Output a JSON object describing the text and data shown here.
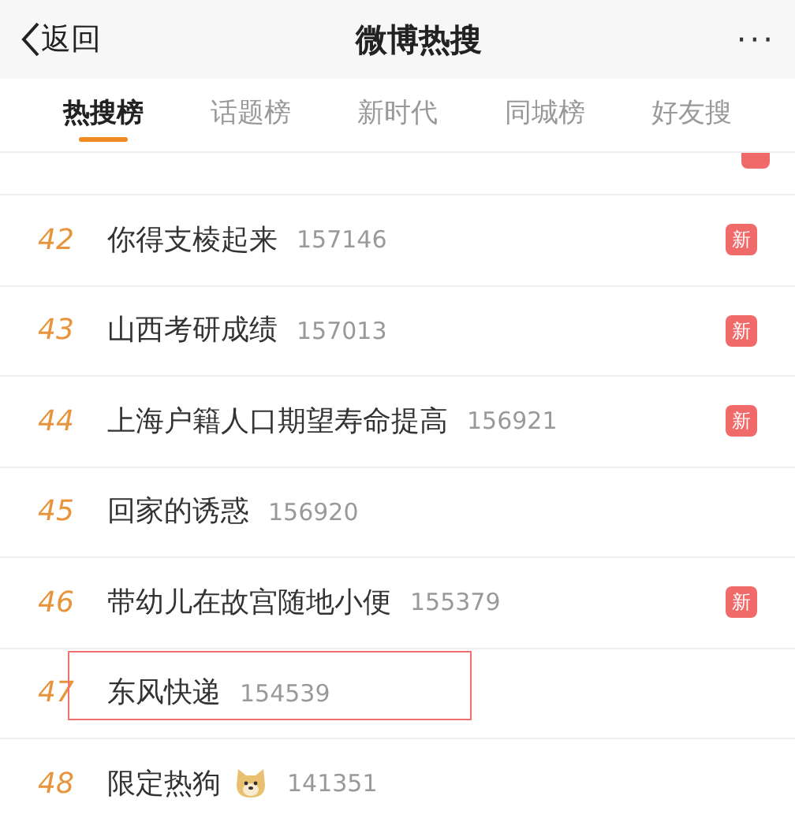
{
  "header": {
    "back": "返回",
    "title": "微博热搜",
    "more": "···"
  },
  "tabs": [
    {
      "label": "热搜榜",
      "selected": true
    },
    {
      "label": "话题榜",
      "selected": false
    },
    {
      "label": "新时代",
      "selected": false
    },
    {
      "label": "同城榜",
      "selected": false
    },
    {
      "label": "好友搜",
      "selected": false
    }
  ],
  "partial_row": {
    "new": true
  },
  "rows": [
    {
      "rank": "42",
      "title": "你得支棱起来",
      "count": "157146",
      "badge": "新",
      "emoji": false,
      "highlighted": false
    },
    {
      "rank": "43",
      "title": "山西考研成绩",
      "count": "157013",
      "badge": "新",
      "emoji": false,
      "highlighted": false
    },
    {
      "rank": "44",
      "title": "上海户籍人口期望寿命提高",
      "count": "156921",
      "badge": "新",
      "emoji": false,
      "highlighted": false
    },
    {
      "rank": "45",
      "title": "回家的诱惑",
      "count": "156920",
      "emoji": false,
      "highlighted": false
    },
    {
      "rank": "46",
      "title": "带幼儿在故宫随地小便",
      "count": "155379",
      "badge": "新",
      "emoji": false,
      "highlighted": false
    },
    {
      "rank": "47",
      "title": "东风快递",
      "count": "154539",
      "emoji": false,
      "highlighted": true
    },
    {
      "rank": "48",
      "title": "限定热狗",
      "count": "141351",
      "emoji": true,
      "highlighted": false
    }
  ]
}
